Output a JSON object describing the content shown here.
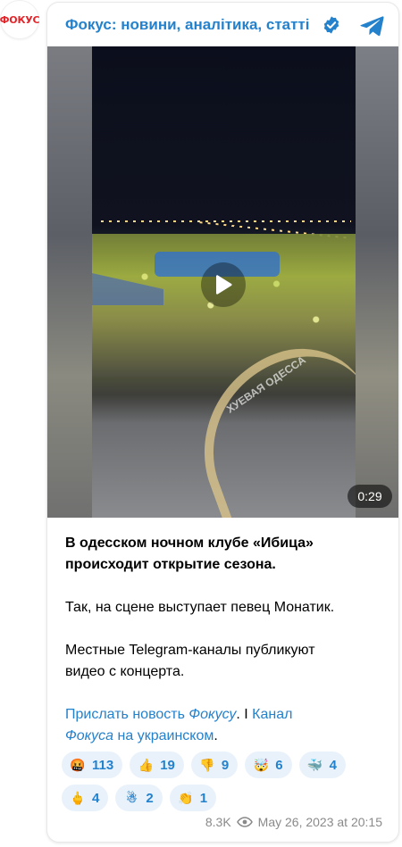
{
  "channel": {
    "avatar_text": "ФОКУС",
    "title": "Фокус: новини, аналітика, статті",
    "verified_icon": "verified-badge-icon",
    "share_icon": "telegram-plane-icon"
  },
  "media": {
    "duration": "0:29",
    "watermark": "ХУЕВАЯ ОДЕССА",
    "play_icon": "play-icon"
  },
  "post": {
    "headline_line1": "В одесском ночном клубе «Ибица»",
    "headline_line2": "происходит открытие сезона.",
    "para2": "Так, на сцене выступает певец Монатик.",
    "para3_line1": "Местные Telegram-каналы публикуют",
    "para3_line2": "видео с концерта.",
    "link1_a": "Прислать новость ",
    "link1_b": "Фокусу",
    "sep": ". I ",
    "link2_a": "Канал",
    "link2_b": "Фокуса",
    "link2_c": " на украинском",
    "tail": "."
  },
  "reactions": [
    {
      "emoji": "🤬",
      "count": "113"
    },
    {
      "emoji": "👍",
      "count": "19"
    },
    {
      "emoji": "👎",
      "count": "9"
    },
    {
      "emoji": "🤯",
      "count": "6"
    },
    {
      "emoji": "🐳",
      "count": "4"
    },
    {
      "emoji": "🖕",
      "count": "4"
    },
    {
      "emoji": "☃",
      "count": "2"
    },
    {
      "emoji": "👏",
      "count": "1"
    }
  ],
  "meta": {
    "views": "8.3K",
    "date": "May 26, 2023 at 20:15"
  },
  "colors": {
    "accent": "#2481cc",
    "brand_red": "#e3262b"
  }
}
